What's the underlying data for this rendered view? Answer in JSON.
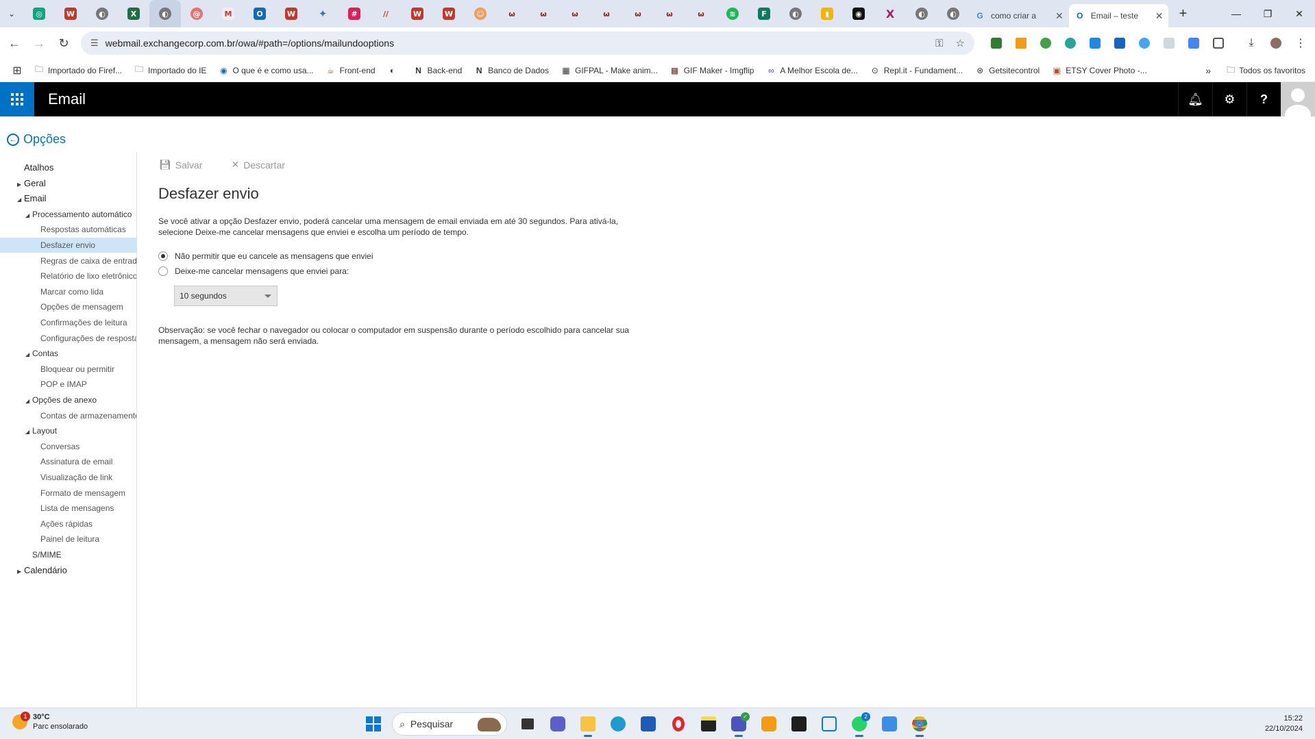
{
  "browser": {
    "tabs": [
      {
        "title": "como criar a",
        "favicon": "google-icon"
      },
      {
        "title": "Email – teste",
        "favicon": "outlook-icon",
        "active": true
      }
    ],
    "address": "webmail.exchangecorp.com.br/owa/#path=/options/mailundooptions",
    "bookmarks": [
      {
        "label": "Importado do Firef...",
        "icon": "folder-icon"
      },
      {
        "label": "Importado do IE",
        "icon": "folder-icon"
      },
      {
        "label": "O que é e como usa...",
        "icon": "site-icon"
      },
      {
        "label": "Front-end",
        "icon": "site-icon"
      },
      {
        "label": "",
        "icon": "globe-icon"
      },
      {
        "label": "Back-end",
        "icon": "notion-icon"
      },
      {
        "label": "Banco de Dados",
        "icon": "notion-icon"
      },
      {
        "label": "GIFPAL - Make anim...",
        "icon": "site-icon"
      },
      {
        "label": "GIF Maker - Imgflip",
        "icon": "site-icon"
      },
      {
        "label": "A Melhor Escola de...",
        "icon": "site-icon"
      },
      {
        "label": "Repl.it - Fundament...",
        "icon": "site-icon"
      },
      {
        "label": "Getsitecontrol",
        "icon": "site-icon"
      },
      {
        "label": "ETSY Cover Photo -...",
        "icon": "site-icon"
      }
    ],
    "all_bookmarks": "Todos os favoritos"
  },
  "owa": {
    "app_title": "Email"
  },
  "options": {
    "back_label": "Opções",
    "nav": [
      {
        "label": "Atalhos",
        "level": 1,
        "arrow": ""
      },
      {
        "label": "Geral",
        "level": 1,
        "arrow": "collapsed"
      },
      {
        "label": "Email",
        "level": 1,
        "arrow": "expanded"
      },
      {
        "label": "Processamento automático",
        "level": 2,
        "arrow": "expanded"
      },
      {
        "label": "Respostas automáticas",
        "level": 3,
        "arrow": ""
      },
      {
        "label": "Desfazer envio",
        "level": 3,
        "arrow": "",
        "selected": true
      },
      {
        "label": "Regras de caixa de entrada",
        "level": 3,
        "arrow": ""
      },
      {
        "label": "Relatório de lixo eletrônico",
        "level": 3,
        "arrow": ""
      },
      {
        "label": "Marcar como lida",
        "level": 3,
        "arrow": ""
      },
      {
        "label": "Opções de mensagem",
        "level": 3,
        "arrow": ""
      },
      {
        "label": "Confirmações de leitura",
        "level": 3,
        "arrow": ""
      },
      {
        "label": "Configurações de resposta",
        "level": 3,
        "arrow": ""
      },
      {
        "label": "Contas",
        "level": 2,
        "arrow": "expanded"
      },
      {
        "label": "Bloquear ou permitir",
        "level": 3,
        "arrow": ""
      },
      {
        "label": "POP e IMAP",
        "level": 3,
        "arrow": ""
      },
      {
        "label": "Opções de anexo",
        "level": 2,
        "arrow": "expanded"
      },
      {
        "label": "Contas de armazenamento",
        "level": 3,
        "arrow": ""
      },
      {
        "label": "Layout",
        "level": 2,
        "arrow": "expanded"
      },
      {
        "label": "Conversas",
        "level": 3,
        "arrow": ""
      },
      {
        "label": "Assinatura de email",
        "level": 3,
        "arrow": ""
      },
      {
        "label": "Visualização de link",
        "level": 3,
        "arrow": ""
      },
      {
        "label": "Formato de mensagem",
        "level": 3,
        "arrow": ""
      },
      {
        "label": "Lista de mensagens",
        "level": 3,
        "arrow": ""
      },
      {
        "label": "Ações rápidas",
        "level": 3,
        "arrow": ""
      },
      {
        "label": "Painel de leitura",
        "level": 3,
        "arrow": ""
      },
      {
        "label": "S/MIME",
        "level": 2,
        "arrow": ""
      },
      {
        "label": "Calendário",
        "level": 1,
        "arrow": "collapsed"
      }
    ],
    "save_label": "Salvar",
    "discard_label": "Descartar",
    "page_title": "Desfazer envio",
    "description": "Se você ativar a opção Desfazer envio, poderá cancelar uma mensagem de email enviada em até 30 segundos. Para ativá-la, selecione Deixe-me cancelar mensagens que enviei e escolha um período de tempo.",
    "radio_no": "Não permitir que eu cancele as mensagens que enviei",
    "radio_yes": "Deixe-me cancelar mensagens que enviei para:",
    "period_selected": "10 segundos",
    "note": "Observação: se você fechar o navegador ou colocar o computador em suspensão durante o período escolhido para cancelar sua mensagem, a mensagem não será enviada."
  },
  "taskbar": {
    "weather_temp": "30°C",
    "weather_desc": "Parc ensolarado",
    "weather_badge": "1",
    "search_label": "Pesquisar",
    "whatsapp_badge": "2",
    "time": "15:22",
    "date": "22/10/2024"
  },
  "colors": {
    "owa_blue": "#0072c6",
    "header_black": "#000000",
    "nav_selected": "#cde6f7"
  }
}
